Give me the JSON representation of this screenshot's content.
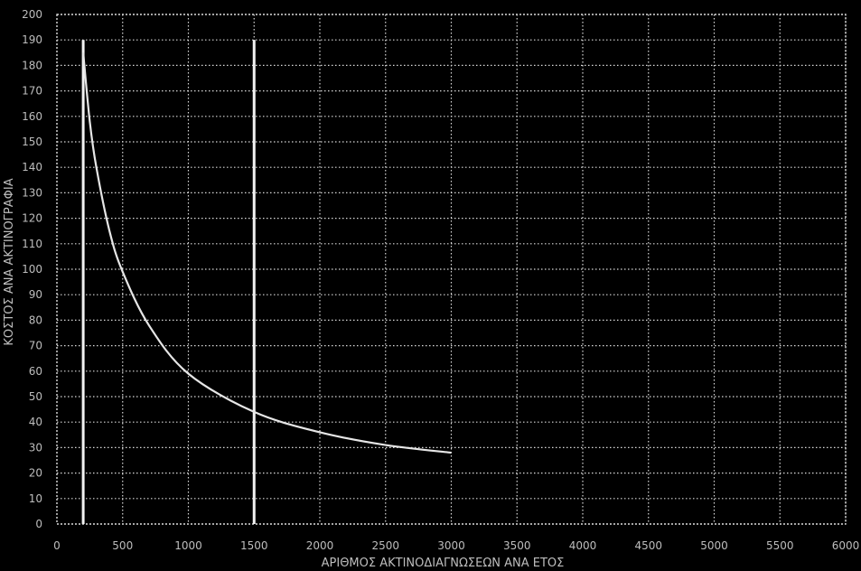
{
  "chart_data": {
    "type": "line",
    "title": "",
    "xlabel": "ΑΡΙΘΜΟΣ ΑΚΤΙΝΟΔΙΑΓΝΩΣΕΩΝ ΑΝΑ ΕΤΟΣ",
    "ylabel": "ΚΟΣΤΟΣ ΑΝΑ ΑΚΤΙΝΟΓΡΑΦΙΑ",
    "xlim": [
      0,
      6000
    ],
    "ylim": [
      0,
      200
    ],
    "x_ticks": [
      0,
      500,
      1000,
      1500,
      2000,
      2500,
      3000,
      3500,
      4000,
      4500,
      5000,
      5500,
      6000
    ],
    "y_ticks": [
      0,
      10,
      20,
      30,
      40,
      50,
      60,
      70,
      80,
      90,
      100,
      110,
      120,
      130,
      140,
      150,
      160,
      170,
      180,
      190,
      200
    ],
    "grid": true,
    "series": [
      {
        "x": [
          200,
          250,
          300,
          400,
          500,
          700,
          1000,
          1500,
          2000,
          2500,
          3000
        ],
        "y": [
          185,
          158,
          140,
          115,
          99,
          78,
          59,
          44,
          36,
          31,
          28
        ]
      }
    ],
    "vertical_markers": [
      200,
      1500
    ],
    "colors": {
      "background": "#000000",
      "line": "#e6e6e6",
      "grid": "#d8d8d8",
      "text": "#bdbdbd"
    }
  }
}
